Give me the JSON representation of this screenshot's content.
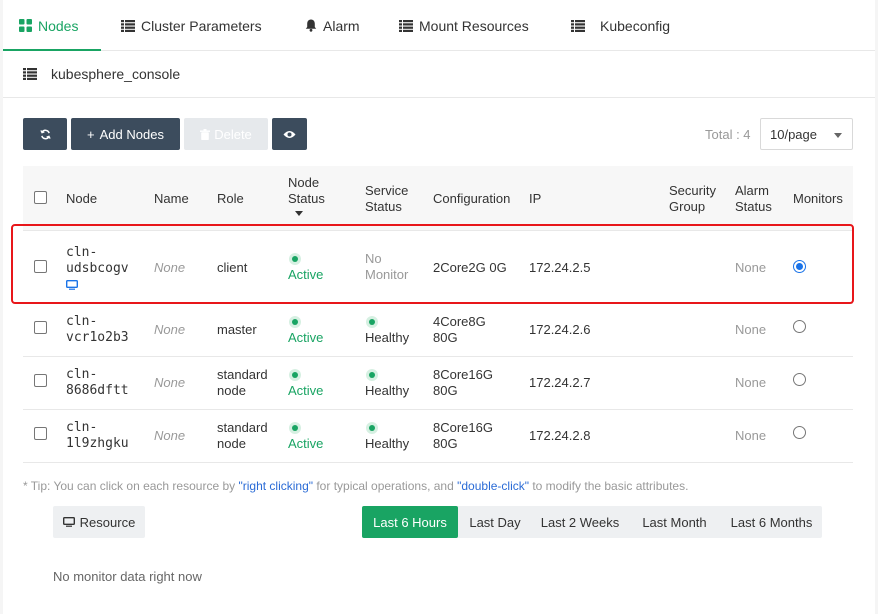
{
  "tabs": [
    {
      "label": "Nodes",
      "icon": "grid-icon",
      "active": true
    },
    {
      "label": "Cluster Parameters",
      "icon": "list-icon"
    },
    {
      "label": "Alarm",
      "icon": "bell-icon"
    },
    {
      "label": "Mount Resources",
      "icon": "list-icon"
    },
    {
      "label": "Kubeconfig",
      "icon": "list-icon"
    }
  ],
  "cluster": {
    "name": "kubesphere_console"
  },
  "toolbar": {
    "add_label": "Add Nodes",
    "delete_label": "Delete",
    "total_label": "Total : 4",
    "page_size": "10/page"
  },
  "table": {
    "headers": {
      "node": "Node",
      "name": "Name",
      "role": "Role",
      "node_status": [
        "Node",
        "Status"
      ],
      "service_status": [
        "Service",
        "Status"
      ],
      "configuration": "Configuration",
      "ip": "IP",
      "security_group": [
        "Security",
        "Group"
      ],
      "alarm_status": [
        "Alarm",
        "Status"
      ],
      "monitors": "Monitors"
    },
    "rows": [
      {
        "node": [
          "cln-",
          "udsbcogv"
        ],
        "name": "None",
        "role": [
          "client"
        ],
        "node_status": "Active",
        "service_status": [
          "No",
          "Monitor"
        ],
        "service_healthy": false,
        "config": [
          "2Core2G 0G"
        ],
        "ip": "172.24.2.5",
        "alarm": "None",
        "monitor_selected": true
      },
      {
        "node": [
          "cln-",
          "vcr1o2b3"
        ],
        "name": "None",
        "role": [
          "master"
        ],
        "node_status": "Active",
        "service_status": [
          "Healthy"
        ],
        "service_healthy": true,
        "config": [
          "4Core8G",
          "80G"
        ],
        "ip": "172.24.2.6",
        "alarm": "None",
        "monitor_selected": false
      },
      {
        "node": [
          "cln-",
          "8686dftt"
        ],
        "name": "None",
        "role": [
          "standard",
          "node"
        ],
        "node_status": "Active",
        "service_status": [
          "Healthy"
        ],
        "service_healthy": true,
        "config": [
          "8Core16G",
          "80G"
        ],
        "ip": "172.24.2.7",
        "alarm": "None",
        "monitor_selected": false
      },
      {
        "node": [
          "cln-",
          "1l9zhgku"
        ],
        "name": "None",
        "role": [
          "standard",
          "node"
        ],
        "node_status": "Active",
        "service_status": [
          "Healthy"
        ],
        "service_healthy": true,
        "config": [
          "8Core16G",
          "80G"
        ],
        "ip": "172.24.2.8",
        "alarm": "None",
        "monitor_selected": false
      }
    ]
  },
  "tip": {
    "prefix": "* Tip: You can click on each resource by ",
    "link1": "\"right clicking\"",
    "middle": " for typical operations, and ",
    "link2": "\"double-click\"",
    "suffix": " to modify the basic attributes."
  },
  "monitor": {
    "resource_label": "Resource",
    "ranges": [
      "Last 6 Hours",
      "Last Day",
      "Last 2 Weeks",
      "Last Month",
      "Last 6 Months"
    ],
    "active_range": "Last 6 Hours",
    "empty_text": "No monitor data right now"
  },
  "colors": {
    "accent": "#19a463",
    "toolbar_button": "#3c4c5d",
    "highlight": "#e8161a",
    "link": "#2a6bd6"
  }
}
